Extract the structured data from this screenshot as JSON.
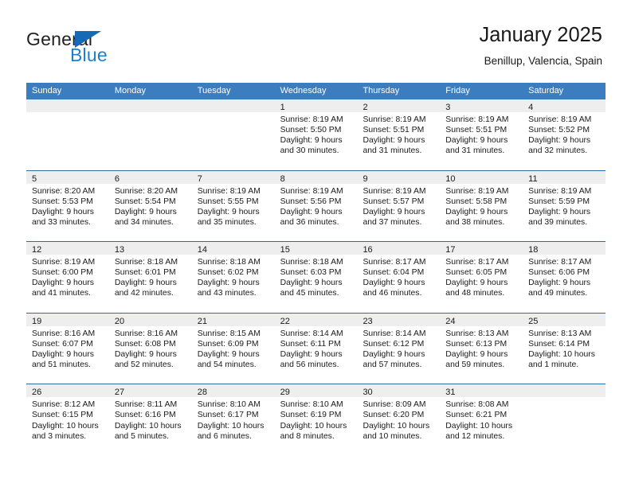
{
  "brand": {
    "word1": "General",
    "word2": "Blue",
    "triangle_color": "#1569b5",
    "blue_color": "#1c7fd1"
  },
  "header": {
    "title": "January 2025",
    "location": "Benillup, Valencia, Spain"
  },
  "theme": {
    "header_bar": "#3b7dbf",
    "row_divider": "#2e6da4",
    "day_band": "#eeeeee"
  },
  "calendar": {
    "weekdays": [
      "Sunday",
      "Monday",
      "Tuesday",
      "Wednesday",
      "Thursday",
      "Friday",
      "Saturday"
    ],
    "weeks": [
      [
        {
          "day": "",
          "lines": []
        },
        {
          "day": "",
          "lines": []
        },
        {
          "day": "",
          "lines": []
        },
        {
          "day": "1",
          "lines": [
            "Sunrise: 8:19 AM",
            "Sunset: 5:50 PM",
            "Daylight: 9 hours",
            "and 30 minutes."
          ]
        },
        {
          "day": "2",
          "lines": [
            "Sunrise: 8:19 AM",
            "Sunset: 5:51 PM",
            "Daylight: 9 hours",
            "and 31 minutes."
          ]
        },
        {
          "day": "3",
          "lines": [
            "Sunrise: 8:19 AM",
            "Sunset: 5:51 PM",
            "Daylight: 9 hours",
            "and 31 minutes."
          ]
        },
        {
          "day": "4",
          "lines": [
            "Sunrise: 8:19 AM",
            "Sunset: 5:52 PM",
            "Daylight: 9 hours",
            "and 32 minutes."
          ]
        }
      ],
      [
        {
          "day": "5",
          "lines": [
            "Sunrise: 8:20 AM",
            "Sunset: 5:53 PM",
            "Daylight: 9 hours",
            "and 33 minutes."
          ]
        },
        {
          "day": "6",
          "lines": [
            "Sunrise: 8:20 AM",
            "Sunset: 5:54 PM",
            "Daylight: 9 hours",
            "and 34 minutes."
          ]
        },
        {
          "day": "7",
          "lines": [
            "Sunrise: 8:19 AM",
            "Sunset: 5:55 PM",
            "Daylight: 9 hours",
            "and 35 minutes."
          ]
        },
        {
          "day": "8",
          "lines": [
            "Sunrise: 8:19 AM",
            "Sunset: 5:56 PM",
            "Daylight: 9 hours",
            "and 36 minutes."
          ]
        },
        {
          "day": "9",
          "lines": [
            "Sunrise: 8:19 AM",
            "Sunset: 5:57 PM",
            "Daylight: 9 hours",
            "and 37 minutes."
          ]
        },
        {
          "day": "10",
          "lines": [
            "Sunrise: 8:19 AM",
            "Sunset: 5:58 PM",
            "Daylight: 9 hours",
            "and 38 minutes."
          ]
        },
        {
          "day": "11",
          "lines": [
            "Sunrise: 8:19 AM",
            "Sunset: 5:59 PM",
            "Daylight: 9 hours",
            "and 39 minutes."
          ]
        }
      ],
      [
        {
          "day": "12",
          "lines": [
            "Sunrise: 8:19 AM",
            "Sunset: 6:00 PM",
            "Daylight: 9 hours",
            "and 41 minutes."
          ]
        },
        {
          "day": "13",
          "lines": [
            "Sunrise: 8:18 AM",
            "Sunset: 6:01 PM",
            "Daylight: 9 hours",
            "and 42 minutes."
          ]
        },
        {
          "day": "14",
          "lines": [
            "Sunrise: 8:18 AM",
            "Sunset: 6:02 PM",
            "Daylight: 9 hours",
            "and 43 minutes."
          ]
        },
        {
          "day": "15",
          "lines": [
            "Sunrise: 8:18 AM",
            "Sunset: 6:03 PM",
            "Daylight: 9 hours",
            "and 45 minutes."
          ]
        },
        {
          "day": "16",
          "lines": [
            "Sunrise: 8:17 AM",
            "Sunset: 6:04 PM",
            "Daylight: 9 hours",
            "and 46 minutes."
          ]
        },
        {
          "day": "17",
          "lines": [
            "Sunrise: 8:17 AM",
            "Sunset: 6:05 PM",
            "Daylight: 9 hours",
            "and 48 minutes."
          ]
        },
        {
          "day": "18",
          "lines": [
            "Sunrise: 8:17 AM",
            "Sunset: 6:06 PM",
            "Daylight: 9 hours",
            "and 49 minutes."
          ]
        }
      ],
      [
        {
          "day": "19",
          "lines": [
            "Sunrise: 8:16 AM",
            "Sunset: 6:07 PM",
            "Daylight: 9 hours",
            "and 51 minutes."
          ]
        },
        {
          "day": "20",
          "lines": [
            "Sunrise: 8:16 AM",
            "Sunset: 6:08 PM",
            "Daylight: 9 hours",
            "and 52 minutes."
          ]
        },
        {
          "day": "21",
          "lines": [
            "Sunrise: 8:15 AM",
            "Sunset: 6:09 PM",
            "Daylight: 9 hours",
            "and 54 minutes."
          ]
        },
        {
          "day": "22",
          "lines": [
            "Sunrise: 8:14 AM",
            "Sunset: 6:11 PM",
            "Daylight: 9 hours",
            "and 56 minutes."
          ]
        },
        {
          "day": "23",
          "lines": [
            "Sunrise: 8:14 AM",
            "Sunset: 6:12 PM",
            "Daylight: 9 hours",
            "and 57 minutes."
          ]
        },
        {
          "day": "24",
          "lines": [
            "Sunrise: 8:13 AM",
            "Sunset: 6:13 PM",
            "Daylight: 9 hours",
            "and 59 minutes."
          ]
        },
        {
          "day": "25",
          "lines": [
            "Sunrise: 8:13 AM",
            "Sunset: 6:14 PM",
            "Daylight: 10 hours",
            "and 1 minute."
          ]
        }
      ],
      [
        {
          "day": "26",
          "lines": [
            "Sunrise: 8:12 AM",
            "Sunset: 6:15 PM",
            "Daylight: 10 hours",
            "and 3 minutes."
          ]
        },
        {
          "day": "27",
          "lines": [
            "Sunrise: 8:11 AM",
            "Sunset: 6:16 PM",
            "Daylight: 10 hours",
            "and 5 minutes."
          ]
        },
        {
          "day": "28",
          "lines": [
            "Sunrise: 8:10 AM",
            "Sunset: 6:17 PM",
            "Daylight: 10 hours",
            "and 6 minutes."
          ]
        },
        {
          "day": "29",
          "lines": [
            "Sunrise: 8:10 AM",
            "Sunset: 6:19 PM",
            "Daylight: 10 hours",
            "and 8 minutes."
          ]
        },
        {
          "day": "30",
          "lines": [
            "Sunrise: 8:09 AM",
            "Sunset: 6:20 PM",
            "Daylight: 10 hours",
            "and 10 minutes."
          ]
        },
        {
          "day": "31",
          "lines": [
            "Sunrise: 8:08 AM",
            "Sunset: 6:21 PM",
            "Daylight: 10 hours",
            "and 12 minutes."
          ]
        },
        {
          "day": "",
          "lines": []
        }
      ]
    ]
  }
}
